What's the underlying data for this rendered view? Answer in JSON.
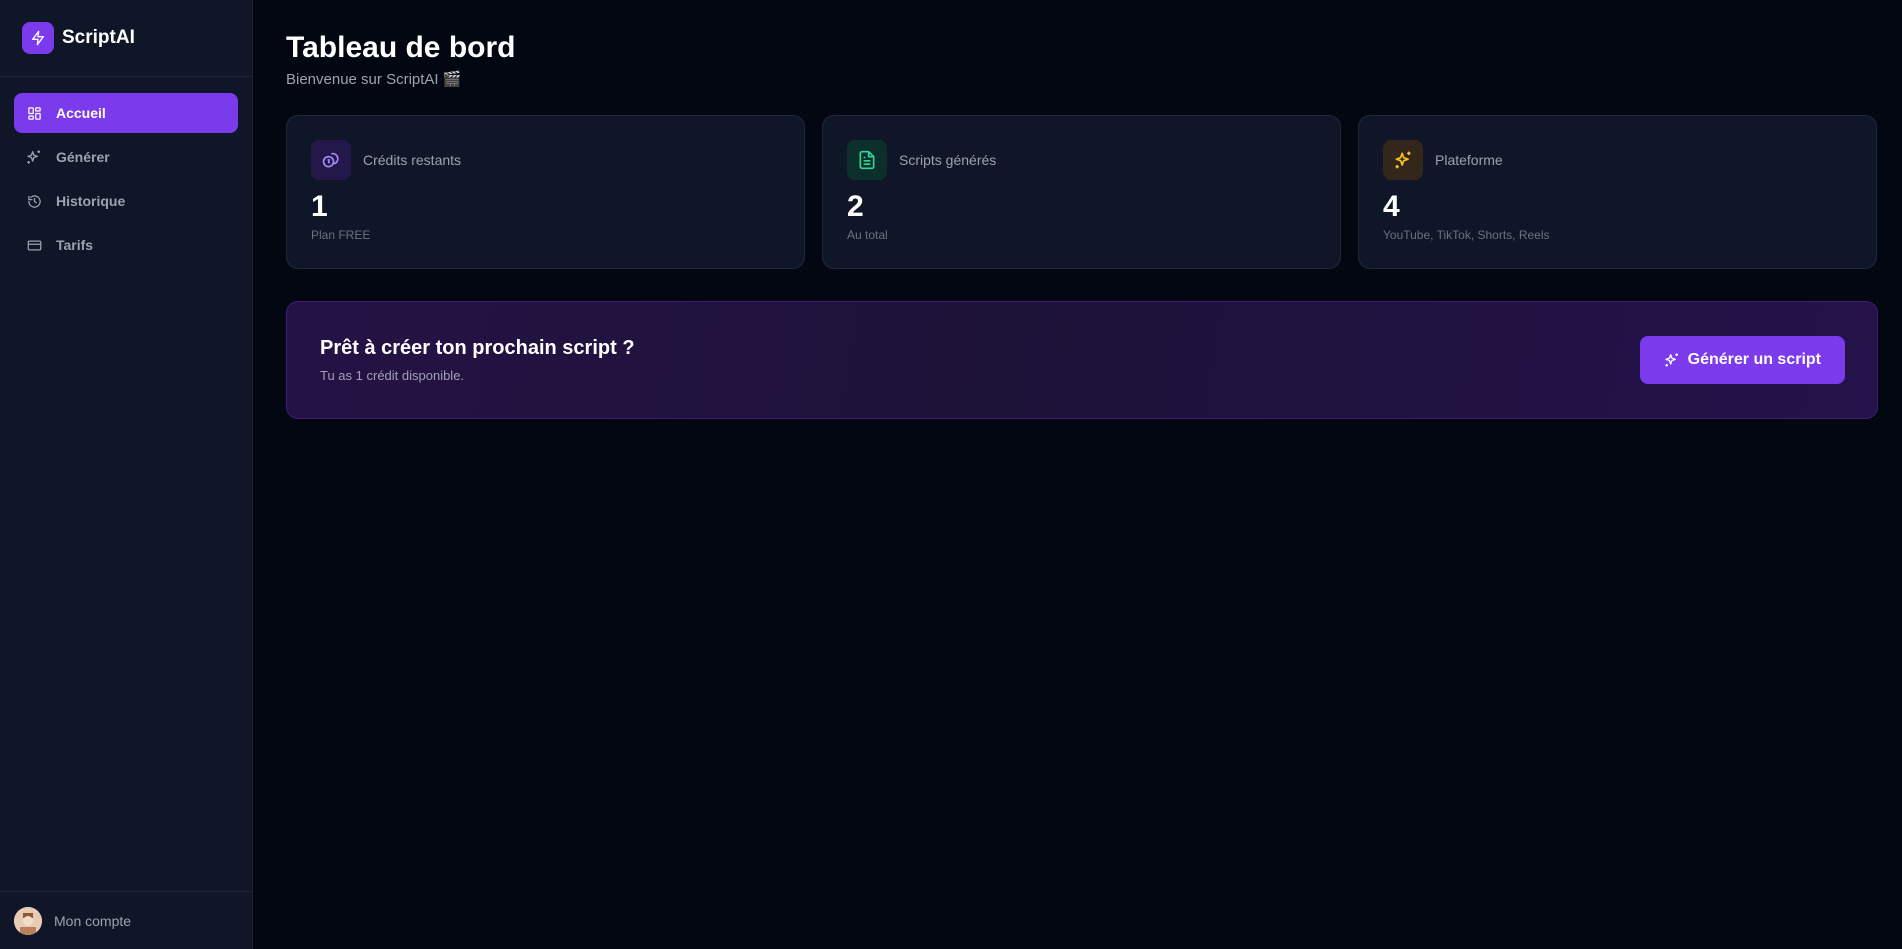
{
  "sidebar": {
    "brand_name": "ScriptAI",
    "items": [
      {
        "label": "Accueil",
        "icon": "dashboard-grid-icon",
        "active": true
      },
      {
        "label": "Générer",
        "icon": "sparkles-icon",
        "active": false
      },
      {
        "label": "Historique",
        "icon": "history-icon",
        "active": false
      },
      {
        "label": "Tarifs",
        "icon": "credit-card-icon",
        "active": false
      }
    ],
    "account_label": "Mon compte"
  },
  "header": {
    "title": "Tableau de bord",
    "subtitle": "Bienvenue sur ScriptAI 🎬"
  },
  "stats": [
    {
      "label": "Crédits restants",
      "value": "1",
      "note": "Plan FREE",
      "icon": "coins-icon",
      "icon_color": "#a78bfa",
      "icon_bg": "#22184a"
    },
    {
      "label": "Scripts générés",
      "value": "2",
      "note": "Au total",
      "icon": "document-icon",
      "icon_color": "#34d399",
      "icon_bg": "#0b2f2b"
    },
    {
      "label": "Plateforme",
      "value": "4",
      "note": "YouTube, TikTok, Shorts, Reels",
      "icon": "sparkles-icon",
      "icon_color": "#fbbf24",
      "icon_bg": "#33261b"
    }
  ],
  "cta": {
    "title": "Prêt à créer ton prochain script ?",
    "subtitle": "Tu as 1 crédit disponible.",
    "button_label": "Générer un script"
  },
  "colors": {
    "accent": "#7c3aed",
    "background": "#030712",
    "sidebar": "#0e1627"
  }
}
